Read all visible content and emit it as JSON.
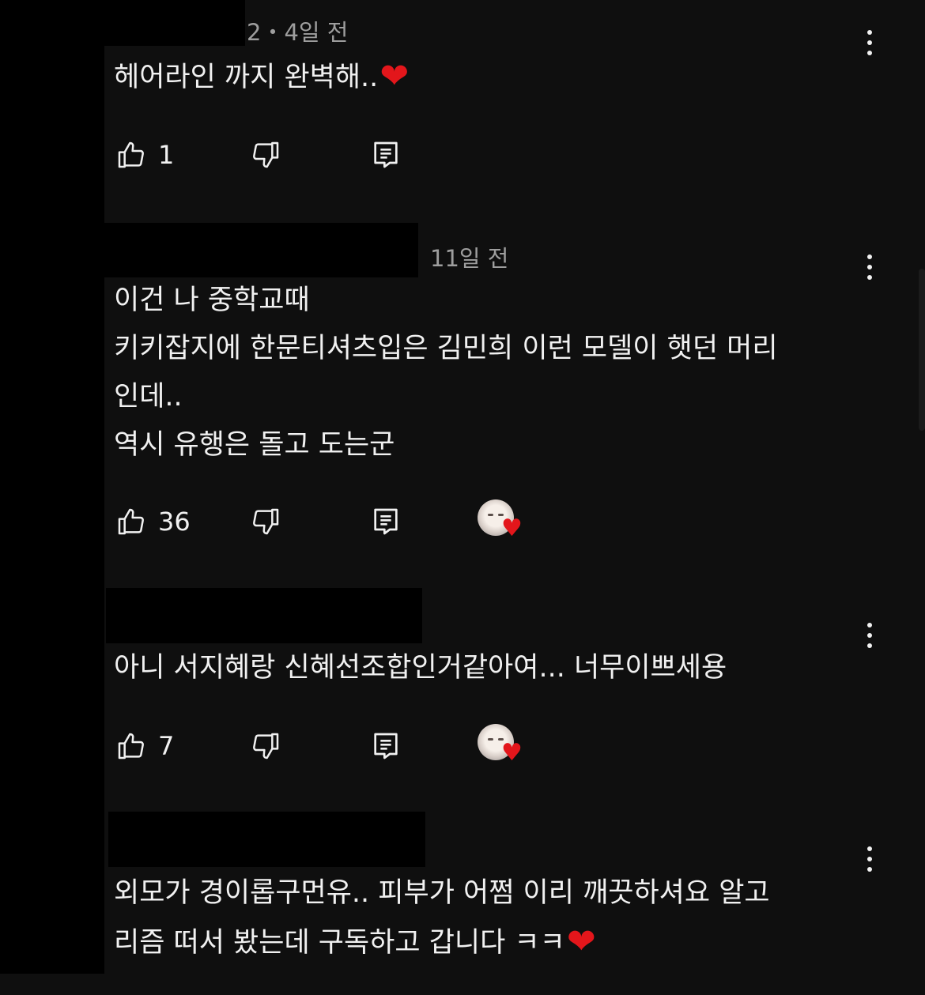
{
  "colors": {
    "background": "#0f0f0f",
    "text": "#f1f1f1",
    "timestamp": "#9e9e9e",
    "heart": "#e3161b"
  },
  "comments": [
    {
      "timestamp": "2・4일 전",
      "lines": [
        "헤어라인 까지 완벽해.."
      ],
      "trailing_emoji": "❤",
      "likes": "1",
      "creator_heart": false
    },
    {
      "timestamp": "11일 전",
      "lines": [
        "이건 나 중학교때",
        "키키잡지에 한문티셔츠입은 김민희 이런 모델이 햇던 머리",
        "인데..",
        "역시 유행은 돌고 도는군"
      ],
      "likes": "36",
      "creator_heart": true
    },
    {
      "timestamp": "",
      "lines": [
        "아니 서지혜랑 신혜선조합인거같아여... 너무이쁘세용"
      ],
      "likes": "7",
      "creator_heart": true
    },
    {
      "timestamp": "",
      "lines": [
        "외모가 경이롭구먼유.. 피부가 어쩜 이리 깨끗하셔요 알고",
        "리즘 떠서 봤는데 구독하고 갑니다 ㅋㅋ"
      ],
      "trailing_emoji": "❤",
      "likes": "",
      "creator_heart": false
    }
  ],
  "icons": {
    "like": "thumbs-up-icon",
    "dislike": "thumbs-down-icon",
    "reply": "reply-icon",
    "menu": "more-vert-icon",
    "creator_heart": "creator-heart-icon"
  }
}
